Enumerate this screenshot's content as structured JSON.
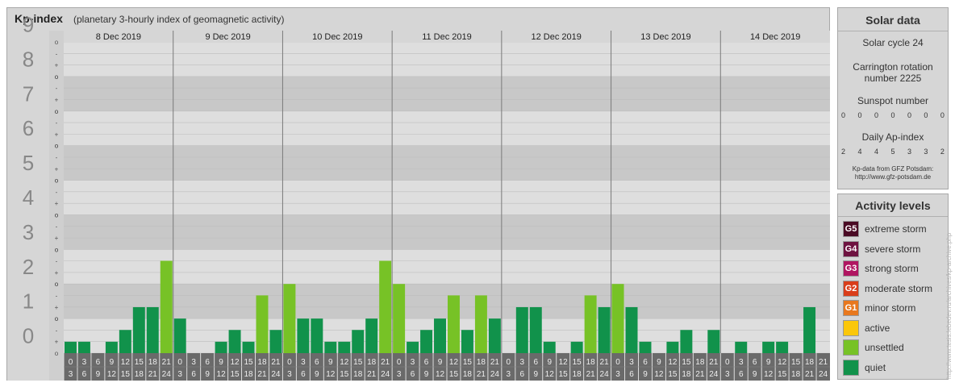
{
  "header": {
    "title": "Kp-index",
    "subtitle": "(planetary 3-hourly index of geomagnetic activity)"
  },
  "chart_data": {
    "type": "bar",
    "title": "Kp-index",
    "subtitle": "(planetary 3-hourly index of geomagnetic activity)",
    "ylim": [
      0,
      9
    ],
    "y_major_labels": [
      "0",
      "1",
      "2",
      "3",
      "4",
      "5",
      "6",
      "7",
      "8",
      "9"
    ],
    "y_minor_labels": [
      "o",
      "+",
      "-",
      "o"
    ],
    "days": [
      "8 Dec 2019",
      "9 Dec 2019",
      "10 Dec 2019",
      "11 Dec 2019",
      "12 Dec 2019",
      "13 Dec 2019",
      "14 Dec 2019"
    ],
    "interval_starts": [
      "0",
      "3",
      "6",
      "9",
      "12",
      "15",
      "18",
      "21"
    ],
    "interval_ends": [
      "3",
      "6",
      "9",
      "12",
      "15",
      "18",
      "21",
      "24"
    ],
    "values": [
      [
        0.33,
        0.33,
        0.0,
        0.33,
        0.67,
        1.33,
        1.33,
        2.67
      ],
      [
        1.0,
        0.0,
        0.0,
        0.33,
        0.67,
        0.33,
        1.67,
        0.67
      ],
      [
        2.0,
        1.0,
        1.0,
        0.33,
        0.33,
        0.67,
        1.0,
        2.67
      ],
      [
        2.0,
        0.33,
        0.67,
        1.0,
        1.67,
        0.67,
        1.67,
        1.0
      ],
      [
        0.0,
        1.33,
        1.33,
        0.33,
        0.0,
        0.33,
        1.67,
        1.33
      ],
      [
        2.0,
        1.33,
        0.33,
        0.0,
        0.33,
        0.67,
        0.0,
        0.67
      ],
      [
        0.0,
        0.33,
        0.0,
        0.33,
        0.33,
        0.0,
        1.33
      ]
    ],
    "category_colors": {
      "quiet": "#11924b",
      "unsettled": "#77c226"
    }
  },
  "solar": {
    "title": "Solar data",
    "cycle": "Solar cycle 24",
    "carrington_line1": "Carrington rotation",
    "carrington_line2": "number 2225",
    "sunspot_label": "Sunspot number",
    "sunspot_values": [
      "0",
      "0",
      "0",
      "0",
      "0",
      "0",
      "0"
    ],
    "ap_label": "Daily Ap-index",
    "ap_values": [
      "2",
      "4",
      "4",
      "5",
      "3",
      "3",
      "2"
    ],
    "source_line1": "Kp-data from GFZ Potsdam:",
    "source_line2": "http://www.gfz-potsdam.de"
  },
  "activity": {
    "title": "Activity levels",
    "levels": [
      {
        "code": "G5",
        "label": "extreme storm",
        "color": "#4a0a24"
      },
      {
        "code": "G4",
        "label": "severe storm",
        "color": "#6e1240"
      },
      {
        "code": "G3",
        "label": "strong storm",
        "color": "#b01561"
      },
      {
        "code": "G2",
        "label": "moderate storm",
        "color": "#d93d1a"
      },
      {
        "code": "G1",
        "label": "minor storm",
        "color": "#e8781e"
      },
      {
        "code": "",
        "label": "active",
        "color": "#fbc70a"
      },
      {
        "code": "",
        "label": "unsettled",
        "color": "#77c226"
      },
      {
        "code": "",
        "label": "quiet",
        "color": "#11924b"
      }
    ]
  },
  "watermark": "http://www.tesis.lebedev.ru/archives/kp-archive.php"
}
